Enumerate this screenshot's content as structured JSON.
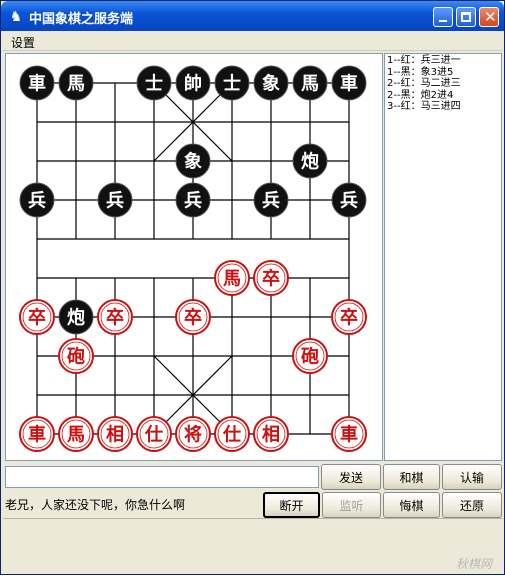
{
  "window": {
    "title": "中国象棋之服务端",
    "icon": "chess-app-icon"
  },
  "menu": {
    "settings": "设置"
  },
  "moves": [
    "1--红：兵三进一",
    "1--黑：象3进5",
    "2--红：马二进三",
    "2--黑：炮2进4",
    "3--红：马三进四"
  ],
  "colors": {
    "red": "#cc1111",
    "black": "#111111",
    "titlebar": "#0a54d6"
  },
  "pieces": [
    {
      "side": "black",
      "char": "車",
      "col": 0,
      "row": 0
    },
    {
      "side": "black",
      "char": "馬",
      "col": 1,
      "row": 0
    },
    {
      "side": "black",
      "char": "士",
      "col": 3,
      "row": 0
    },
    {
      "side": "black",
      "char": "帥",
      "col": 4,
      "row": 0
    },
    {
      "side": "black",
      "char": "士",
      "col": 5,
      "row": 0
    },
    {
      "side": "black",
      "char": "象",
      "col": 6,
      "row": 0
    },
    {
      "side": "black",
      "char": "馬",
      "col": 7,
      "row": 0
    },
    {
      "side": "black",
      "char": "車",
      "col": 8,
      "row": 0
    },
    {
      "side": "black",
      "char": "象",
      "col": 4,
      "row": 2
    },
    {
      "side": "black",
      "char": "炮",
      "col": 7,
      "row": 2
    },
    {
      "side": "black",
      "char": "兵",
      "col": 0,
      "row": 3
    },
    {
      "side": "black",
      "char": "兵",
      "col": 2,
      "row": 3
    },
    {
      "side": "black",
      "char": "兵",
      "col": 4,
      "row": 3
    },
    {
      "side": "black",
      "char": "兵",
      "col": 6,
      "row": 3
    },
    {
      "side": "black",
      "char": "兵",
      "col": 8,
      "row": 3
    },
    {
      "side": "red",
      "char": "馬",
      "col": 5,
      "row": 5
    },
    {
      "side": "red",
      "char": "卒",
      "col": 6,
      "row": 5
    },
    {
      "side": "red",
      "char": "卒",
      "col": 0,
      "row": 6
    },
    {
      "side": "black",
      "char": "炮",
      "col": 1,
      "row": 6
    },
    {
      "side": "red",
      "char": "卒",
      "col": 2,
      "row": 6
    },
    {
      "side": "red",
      "char": "卒",
      "col": 4,
      "row": 6
    },
    {
      "side": "red",
      "char": "卒",
      "col": 8,
      "row": 6
    },
    {
      "side": "red",
      "char": "砲",
      "col": 1,
      "row": 7
    },
    {
      "side": "red",
      "char": "砲",
      "col": 7,
      "row": 7
    },
    {
      "side": "red",
      "char": "車",
      "col": 0,
      "row": 9
    },
    {
      "side": "red",
      "char": "馬",
      "col": 1,
      "row": 9
    },
    {
      "side": "red",
      "char": "相",
      "col": 2,
      "row": 9
    },
    {
      "side": "red",
      "char": "仕",
      "col": 3,
      "row": 9
    },
    {
      "side": "red",
      "char": "将",
      "col": 4,
      "row": 9
    },
    {
      "side": "red",
      "char": "仕",
      "col": 5,
      "row": 9
    },
    {
      "side": "red",
      "char": "相",
      "col": 6,
      "row": 9
    },
    {
      "side": "red",
      "char": "車",
      "col": 8,
      "row": 9
    }
  ],
  "controls": {
    "chat_input_value": "",
    "send": "发送",
    "draw": "和棋",
    "resign": "认输",
    "disconnect": "断开",
    "listen": "监听",
    "undo": "悔棋",
    "restore": "还原"
  },
  "message": "老兄，人家还没下呢，你急什么啊",
  "watermark": "秋棋网"
}
